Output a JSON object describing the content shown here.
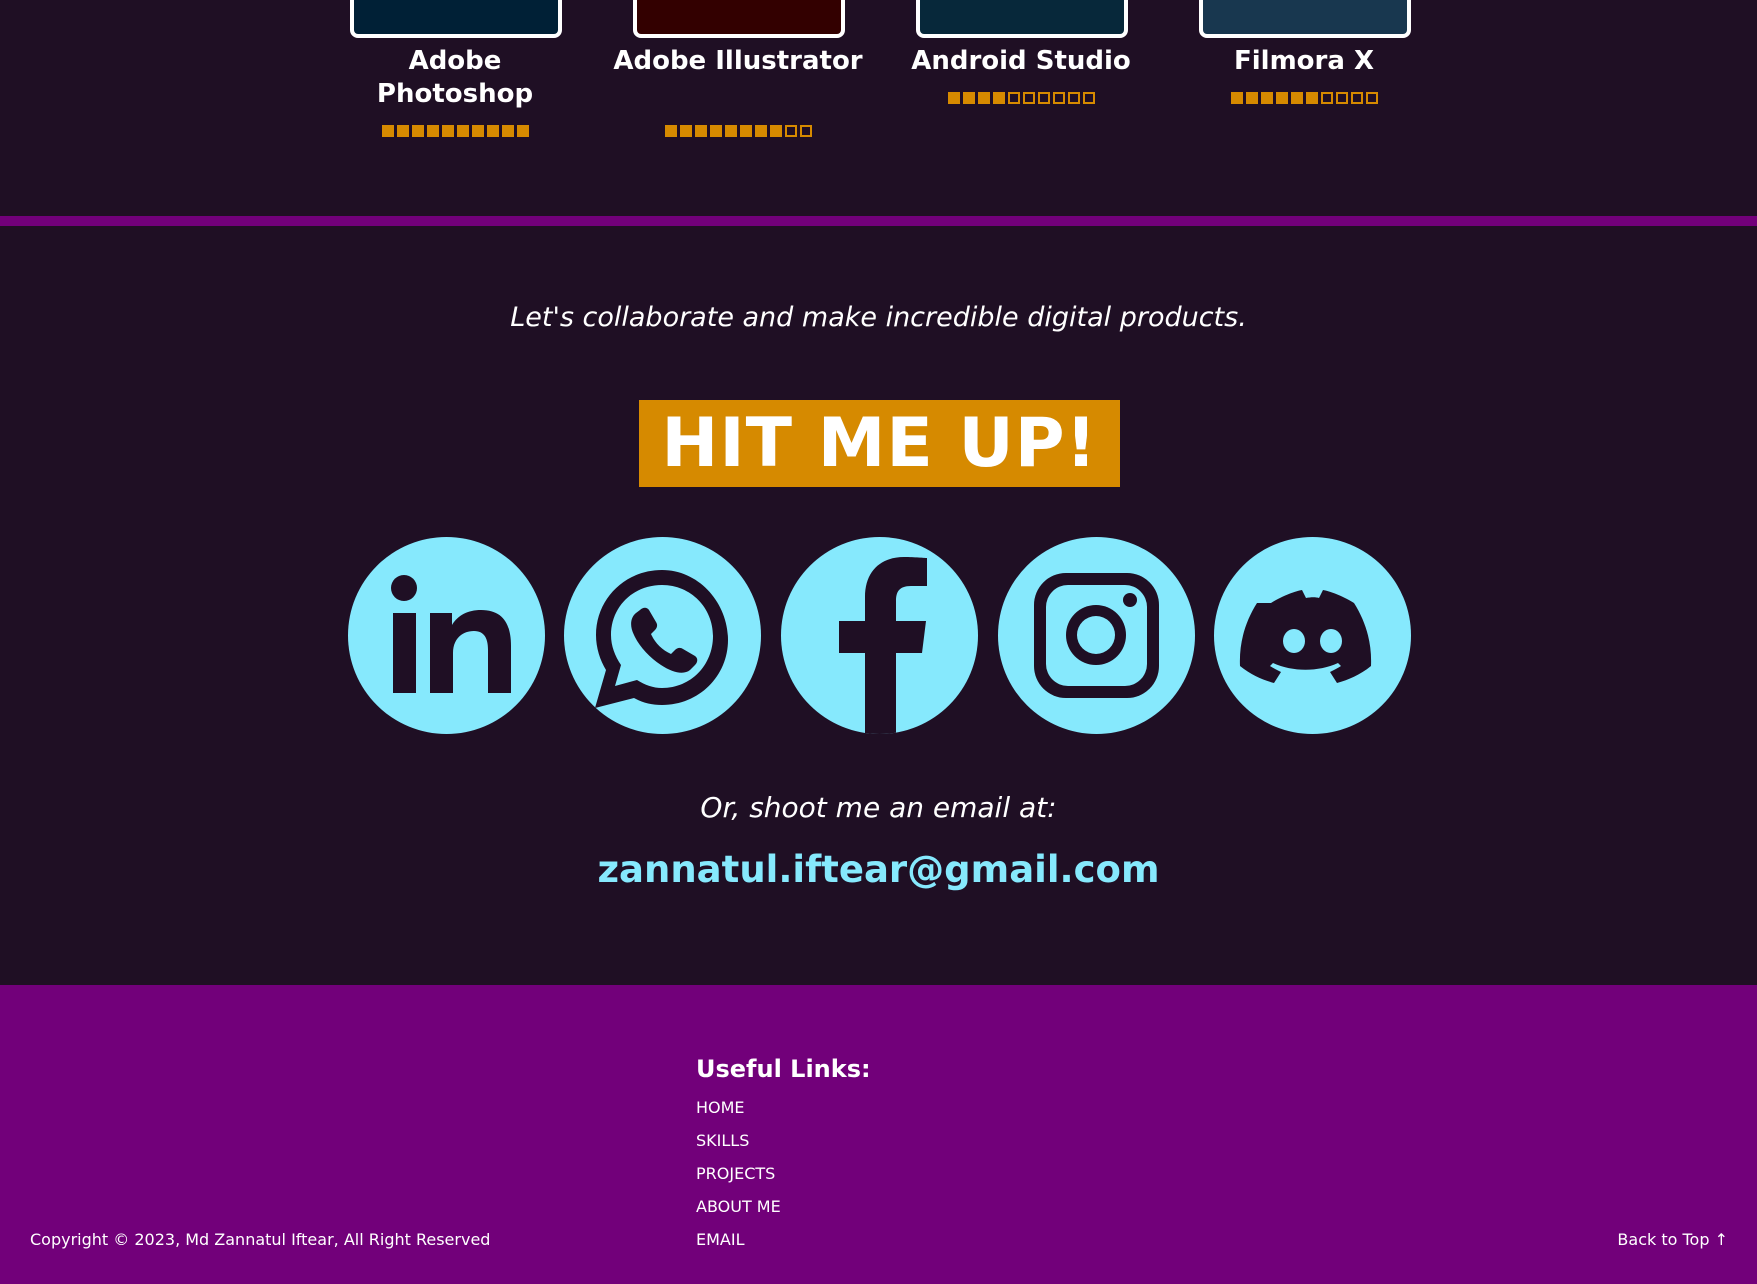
{
  "skills": [
    {
      "name": "Adobe Photoshop",
      "rating": 10,
      "max": 10,
      "thumb_color": "#002036"
    },
    {
      "name": "Adobe Illustrator",
      "rating": 8,
      "max": 10,
      "thumb_color": "#330000"
    },
    {
      "name": "Android Studio",
      "rating": 4,
      "max": 10,
      "thumb_color": "#07283a"
    },
    {
      "name": "Filmora X",
      "rating": 6,
      "max": 10,
      "thumb_color": "#18374f"
    }
  ],
  "contact": {
    "tagline": "Let's collaborate and make incredible digital products.",
    "cta_label": "HIT ME UP!",
    "socials": [
      "linkedin-icon",
      "whatsapp-icon",
      "facebook-icon",
      "instagram-icon",
      "discord-icon"
    ],
    "email_prompt": "Or, shoot me an email at:",
    "email": "zannatul.iftear@gmail.com"
  },
  "footer": {
    "links_title": "Useful Links:",
    "links": [
      "HOME",
      "SKILLS",
      "PROJECTS",
      "ABOUT ME",
      "EMAIL"
    ],
    "copyright": "Copyright © 2023, Md Zannatul Iftear, All Right Reserved",
    "back_to_top": "Back to Top ↑"
  },
  "colors": {
    "background": "#1f0f24",
    "accent_purple": "#72007a",
    "accent_orange": "#d68a00",
    "accent_cyan": "#86e9fd"
  }
}
